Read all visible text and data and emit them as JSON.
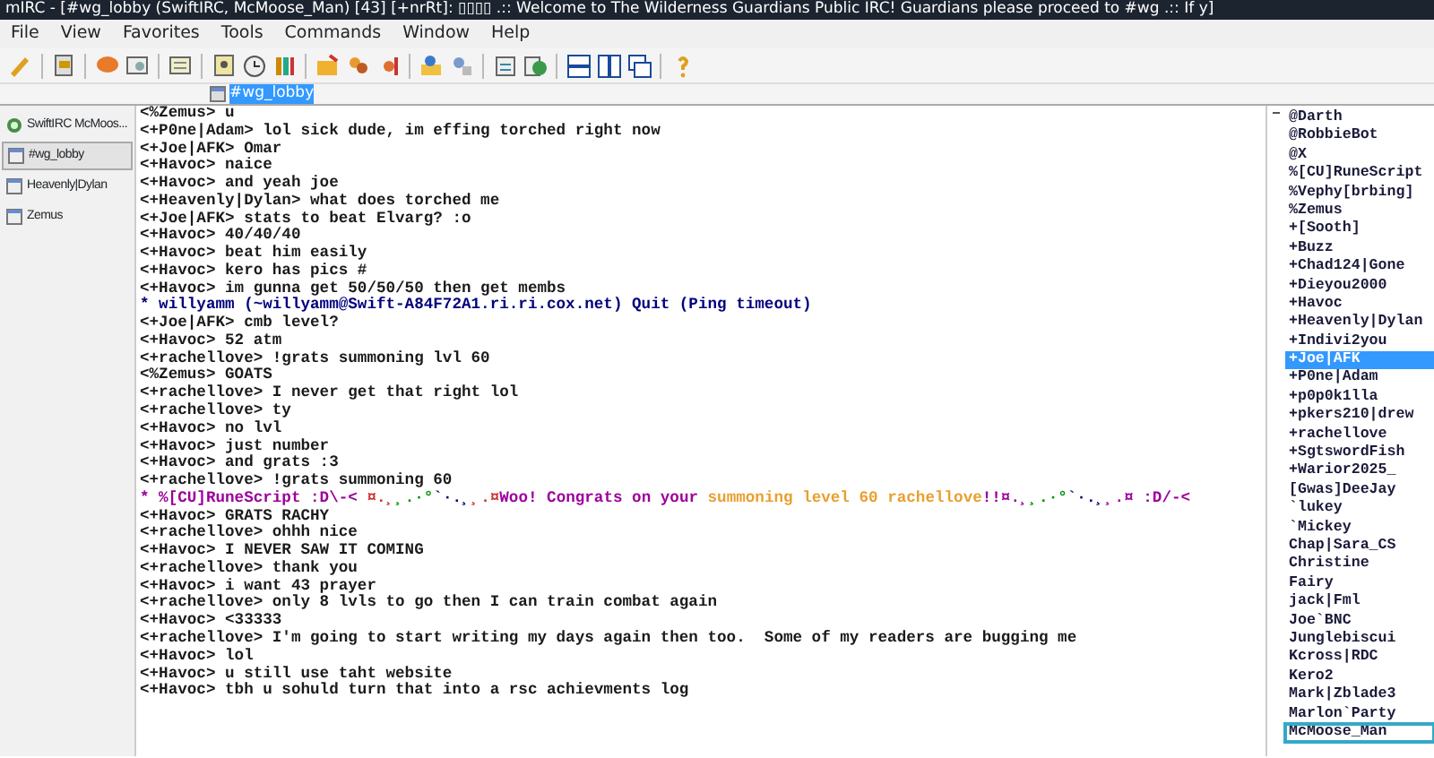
{
  "window": {
    "title": "mIRC - [#wg_lobby (SwiftIRC, McMoose_Man) [43] [+nrRt]: ▯▯▯▯ .:: Welcome to The Wilderness Guardians Public IRC! Guardians please proceed to #wg .:: If y]"
  },
  "menu": [
    "File",
    "View",
    "Favorites",
    "Tools",
    "Commands",
    "Window",
    "Help"
  ],
  "switchbar": [
    {
      "label": "#wg_lobby",
      "selected": true
    }
  ],
  "treebar": {
    "items": [
      {
        "label": "SwiftIRC McMoos...",
        "kind": "server",
        "selected": false
      },
      {
        "label": "#wg_lobby",
        "kind": "channel",
        "selected": true
      },
      {
        "label": "Heavenly|Dylan",
        "kind": "query",
        "selected": false
      },
      {
        "label": "Zemus",
        "kind": "query",
        "selected": false
      }
    ]
  },
  "chat": {
    "lines": [
      {
        "segments": [
          {
            "text": "<%Zemus> u",
            "color": "#1a1a1a"
          }
        ]
      },
      {
        "segments": [
          {
            "text": "<+P0ne|Adam> lol sick dude, im effing torched right now",
            "color": "#1a1a1a"
          }
        ]
      },
      {
        "segments": [
          {
            "text": "<+Joe|AFK> Omar",
            "color": "#1a1a1a"
          }
        ]
      },
      {
        "segments": [
          {
            "text": "<+Havoc> naice",
            "color": "#1a1a1a"
          }
        ]
      },
      {
        "segments": [
          {
            "text": "<+Havoc> and yeah joe",
            "color": "#1a1a1a"
          }
        ]
      },
      {
        "segments": [
          {
            "text": "<+Heavenly|Dylan> what does torched me",
            "color": "#1a1a1a"
          }
        ]
      },
      {
        "segments": [
          {
            "text": "<+Joe|AFK> stats to beat Elvarg? :o",
            "color": "#1a1a1a"
          }
        ]
      },
      {
        "segments": [
          {
            "text": "<+Havoc> 40/40/40",
            "color": "#1a1a1a"
          }
        ]
      },
      {
        "segments": [
          {
            "text": "<+Havoc> beat him easily",
            "color": "#1a1a1a"
          }
        ]
      },
      {
        "segments": [
          {
            "text": "<+Havoc> kero has pics #",
            "color": "#1a1a1a"
          }
        ]
      },
      {
        "segments": [
          {
            "text": "<+Havoc> im gunna get 50/50/50 then get membs",
            "color": "#1a1a1a"
          }
        ]
      },
      {
        "segments": [
          {
            "text": "* willyamm (~willyamm@Swift-A84F72A1.ri.ri.cox.net) Quit (Ping timeout)",
            "color": "#00007f"
          }
        ]
      },
      {
        "segments": [
          {
            "text": "<+Joe|AFK> cmb level?",
            "color": "#1a1a1a"
          }
        ]
      },
      {
        "segments": [
          {
            "text": "<+Havoc> 52 atm",
            "color": "#1a1a1a"
          }
        ]
      },
      {
        "segments": [
          {
            "text": "<+rachellove> !grats summoning lvl 60",
            "color": "#1a1a1a"
          }
        ]
      },
      {
        "segments": [
          {
            "text": "<%Zemus> GOATS",
            "color": "#1a1a1a"
          }
        ]
      },
      {
        "segments": [
          {
            "text": "<+rachellove> I never get that right lol",
            "color": "#1a1a1a"
          }
        ]
      },
      {
        "segments": [
          {
            "text": "<+rachellove> ty",
            "color": "#1a1a1a"
          }
        ]
      },
      {
        "segments": [
          {
            "text": "<+Havoc> no lvl",
            "color": "#1a1a1a"
          }
        ]
      },
      {
        "segments": [
          {
            "text": "<+Havoc> just number",
            "color": "#1a1a1a"
          }
        ]
      },
      {
        "segments": [
          {
            "text": "<+Havoc> and grats :3",
            "color": "#1a1a1a"
          }
        ]
      },
      {
        "segments": [
          {
            "text": "<+rachellove> !grats summoning 60",
            "color": "#1a1a1a"
          }
        ]
      },
      {
        "segments": [
          {
            "text": "* %[CU]RuneScript :D\\-< ",
            "color": "#9c009c"
          },
          {
            "text": "¤.¸",
            "color": "#cc3333"
          },
          {
            "text": "¸.·°",
            "color": "#009300"
          },
          {
            "text": "`·.¸",
            "color": "#00007f"
          },
          {
            "text": "¸.¤",
            "color": "#cc3333"
          },
          {
            "text": "Woo! Congrats on your ",
            "color": "#9c009c"
          },
          {
            "text": "summoning level 60 rachellove",
            "color": "#e8a030"
          },
          {
            "text": "!!¤.¸",
            "color": "#9c009c"
          },
          {
            "text": "¸.·°",
            "color": "#009300"
          },
          {
            "text": "`·.¸",
            "color": "#00007f"
          },
          {
            "text": "¸.¤ :D/-<",
            "color": "#9c009c"
          }
        ]
      },
      {
        "segments": [
          {
            "text": "<+Havoc> GRATS RACHY",
            "color": "#1a1a1a"
          }
        ]
      },
      {
        "segments": [
          {
            "text": "<+rachellove> ohhh nice",
            "color": "#1a1a1a"
          }
        ]
      },
      {
        "segments": [
          {
            "text": "<+Havoc> I NEVER SAW IT COMING",
            "color": "#1a1a1a"
          }
        ]
      },
      {
        "segments": [
          {
            "text": "<+rachellove> thank you",
            "color": "#1a1a1a"
          }
        ]
      },
      {
        "segments": [
          {
            "text": "<+Havoc> i want 43 prayer",
            "color": "#1a1a1a"
          }
        ]
      },
      {
        "segments": [
          {
            "text": "<+rachellove> only 8 lvls to go then I can train combat again",
            "color": "#1a1a1a"
          }
        ]
      },
      {
        "segments": [
          {
            "text": "<+Havoc> <33333",
            "color": "#1a1a1a"
          }
        ]
      },
      {
        "segments": [
          {
            "text": "<+rachellove> I'm going to start writing my days again then too.  Some of my readers are bugging me",
            "color": "#1a1a1a"
          }
        ]
      },
      {
        "segments": [
          {
            "text": "<+Havoc> lol",
            "color": "#1a1a1a"
          }
        ]
      },
      {
        "segments": [
          {
            "text": "<+Havoc> u still use taht website",
            "color": "#1a1a1a"
          }
        ]
      },
      {
        "segments": [
          {
            "text": "<+Havoc> tbh u sohuld turn that into a rsc achievments log",
            "color": "#1a1a1a"
          }
        ]
      }
    ]
  },
  "nicklist": [
    {
      "nick": "@Darth",
      "selected": false,
      "focused": false
    },
    {
      "nick": "@RobbieBot",
      "selected": false,
      "focused": false
    },
    {
      "nick": "@X",
      "selected": false,
      "focused": false
    },
    {
      "nick": "%[CU]RuneScript",
      "selected": false,
      "focused": false
    },
    {
      "nick": "%Vephy[brbing]",
      "selected": false,
      "focused": false
    },
    {
      "nick": "%Zemus",
      "selected": false,
      "focused": false
    },
    {
      "nick": "+[Sooth]",
      "selected": false,
      "focused": false
    },
    {
      "nick": "+Buzz",
      "selected": false,
      "focused": false
    },
    {
      "nick": "+Chad124|Gone",
      "selected": false,
      "focused": false
    },
    {
      "nick": "+Dieyou2000",
      "selected": false,
      "focused": false
    },
    {
      "nick": "+Havoc",
      "selected": false,
      "focused": false
    },
    {
      "nick": "+Heavenly|Dylan",
      "selected": false,
      "focused": false
    },
    {
      "nick": "+Indivi2you",
      "selected": false,
      "focused": false
    },
    {
      "nick": "+Joe|AFK",
      "selected": true,
      "focused": false
    },
    {
      "nick": "+P0ne|Adam",
      "selected": false,
      "focused": false
    },
    {
      "nick": "+p0p0k1lla",
      "selected": false,
      "focused": false
    },
    {
      "nick": "+pkers210|drew",
      "selected": false,
      "focused": false
    },
    {
      "nick": "+rachellove",
      "selected": false,
      "focused": false
    },
    {
      "nick": "+SgtswordFish",
      "selected": false,
      "focused": false
    },
    {
      "nick": "+Warior2025_",
      "selected": false,
      "focused": false
    },
    {
      "nick": "[Gwas]DeeJay",
      "selected": false,
      "focused": false
    },
    {
      "nick": "`lukey",
      "selected": false,
      "focused": false
    },
    {
      "nick": "`Mickey",
      "selected": false,
      "focused": false
    },
    {
      "nick": "Chap|Sara_CS",
      "selected": false,
      "focused": false
    },
    {
      "nick": "Christine",
      "selected": false,
      "focused": false
    },
    {
      "nick": "Fairy",
      "selected": false,
      "focused": false
    },
    {
      "nick": "jack|Fml",
      "selected": false,
      "focused": false
    },
    {
      "nick": "Joe`BNC",
      "selected": false,
      "focused": false
    },
    {
      "nick": "Junglebiscui",
      "selected": false,
      "focused": false
    },
    {
      "nick": "Kcross|RDC",
      "selected": false,
      "focused": false
    },
    {
      "nick": "Kero2",
      "selected": false,
      "focused": false
    },
    {
      "nick": "Mark|Zblade3",
      "selected": false,
      "focused": false
    },
    {
      "nick": "Marlon`Party",
      "selected": false,
      "focused": false
    },
    {
      "nick": "McMoose_Man",
      "selected": false,
      "focused": true
    }
  ]
}
